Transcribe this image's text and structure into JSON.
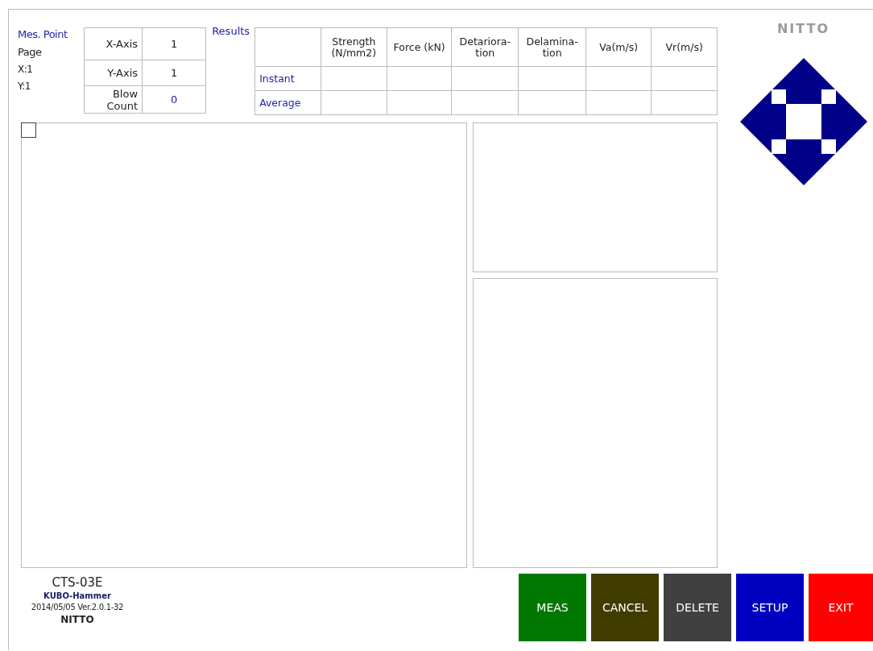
{
  "mes_point": {
    "title": "Mes. Point",
    "page": "Page",
    "x": "X:1",
    "y": "Y:1"
  },
  "axis_table": [
    {
      "label": "X-Axis",
      "value": "1",
      "highlight": false
    },
    {
      "label": "Y-Axis",
      "value": "1",
      "highlight": false
    },
    {
      "label": "Blow Count",
      "value": "0",
      "highlight": true
    }
  ],
  "results": {
    "title": "Results",
    "columns": [
      "Strength (N/mm2)",
      "Force (kN)",
      "Detariora- tion",
      "Delamina- tion",
      "Va(m/s)",
      "Vr(m/s)"
    ],
    "rows": [
      "Instant",
      "Average"
    ]
  },
  "brand": "NITTO",
  "checkbox": {
    "checked": false
  },
  "info": {
    "model": "CTS-03E",
    "product": "KUBO-Hammer",
    "version": "2014/05/05 Ver.2.0.1-32",
    "maker": "NITTO"
  },
  "buttons": [
    {
      "label": "MEAS",
      "color": "#007800"
    },
    {
      "label": "CANCEL",
      "color": "#403c00"
    },
    {
      "label": "DELETE",
      "color": "#404040"
    },
    {
      "label": "SETUP",
      "color": "#0000c0"
    },
    {
      "label": "EXIT",
      "color": "#ff0000"
    }
  ]
}
